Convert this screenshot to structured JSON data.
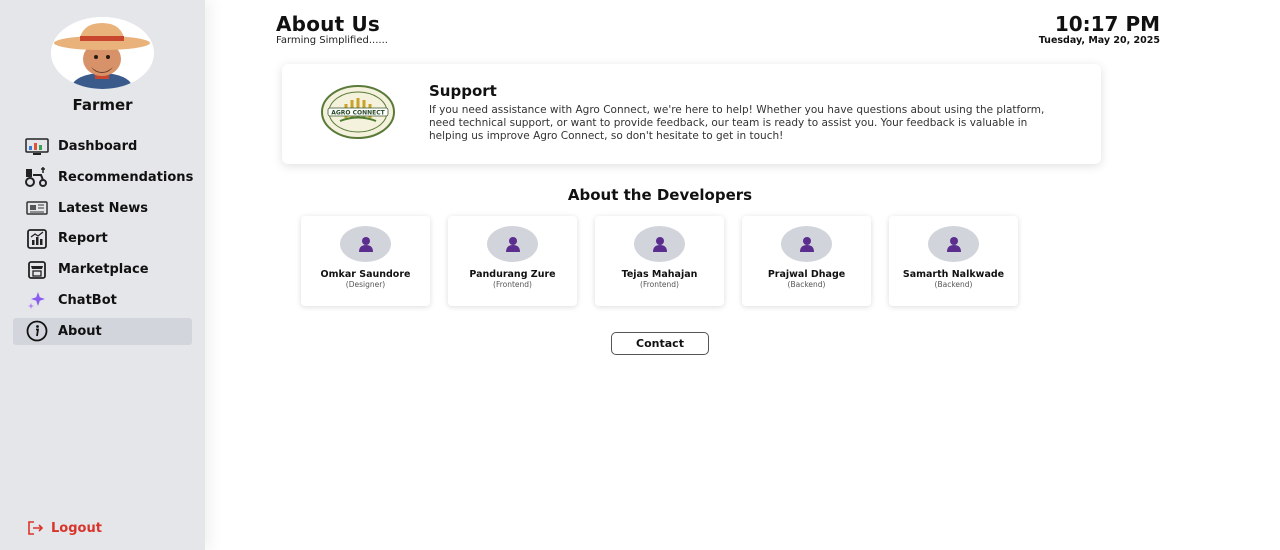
{
  "sidebar": {
    "profile_name": "Farmer",
    "items": [
      {
        "label": "Dashboard",
        "icon": "dashboard-icon"
      },
      {
        "label": "Recommendations",
        "icon": "recommendations-icon"
      },
      {
        "label": "Latest News",
        "icon": "news-icon"
      },
      {
        "label": "Report",
        "icon": "report-icon"
      },
      {
        "label": "Marketplace",
        "icon": "marketplace-icon"
      },
      {
        "label": "ChatBot",
        "icon": "sparkle-icon"
      },
      {
        "label": "About",
        "icon": "info-icon",
        "active": true
      }
    ],
    "logout_label": "Logout"
  },
  "header": {
    "title": "About Us",
    "subtitle": "Farming Simplified......",
    "time": "10:17 PM",
    "date": "Tuesday, May 20, 2025"
  },
  "support": {
    "title": "Support",
    "text": "If you need assistance with Agro Connect, we're here to help! Whether you have questions about using the platform, need technical support, or want to provide feedback, our team is ready to assist you. Your feedback is valuable in helping us improve Agro Connect, so don't hesitate to get in touch!",
    "logo_text": "AGRO CONNECT"
  },
  "developers": {
    "heading": "About the Developers",
    "members": [
      {
        "name": "Omkar Saundore",
        "role": "(Designer)"
      },
      {
        "name": "Pandurang Zure",
        "role": "(Frontend)"
      },
      {
        "name": "Tejas Mahajan",
        "role": "(Frontend)"
      },
      {
        "name": "Prajwal Dhage",
        "role": "(Backend)"
      },
      {
        "name": "Samarth Nalkwade",
        "role": "(Backend)"
      }
    ]
  },
  "contact_label": "Contact",
  "colors": {
    "sidebar_bg": "#e5e6ea",
    "active_item_bg": "#d3d5dc",
    "logout": "#d9342b",
    "dev_icon": "#5b2d8e",
    "dev_avatar_bg": "#d2d4db"
  }
}
